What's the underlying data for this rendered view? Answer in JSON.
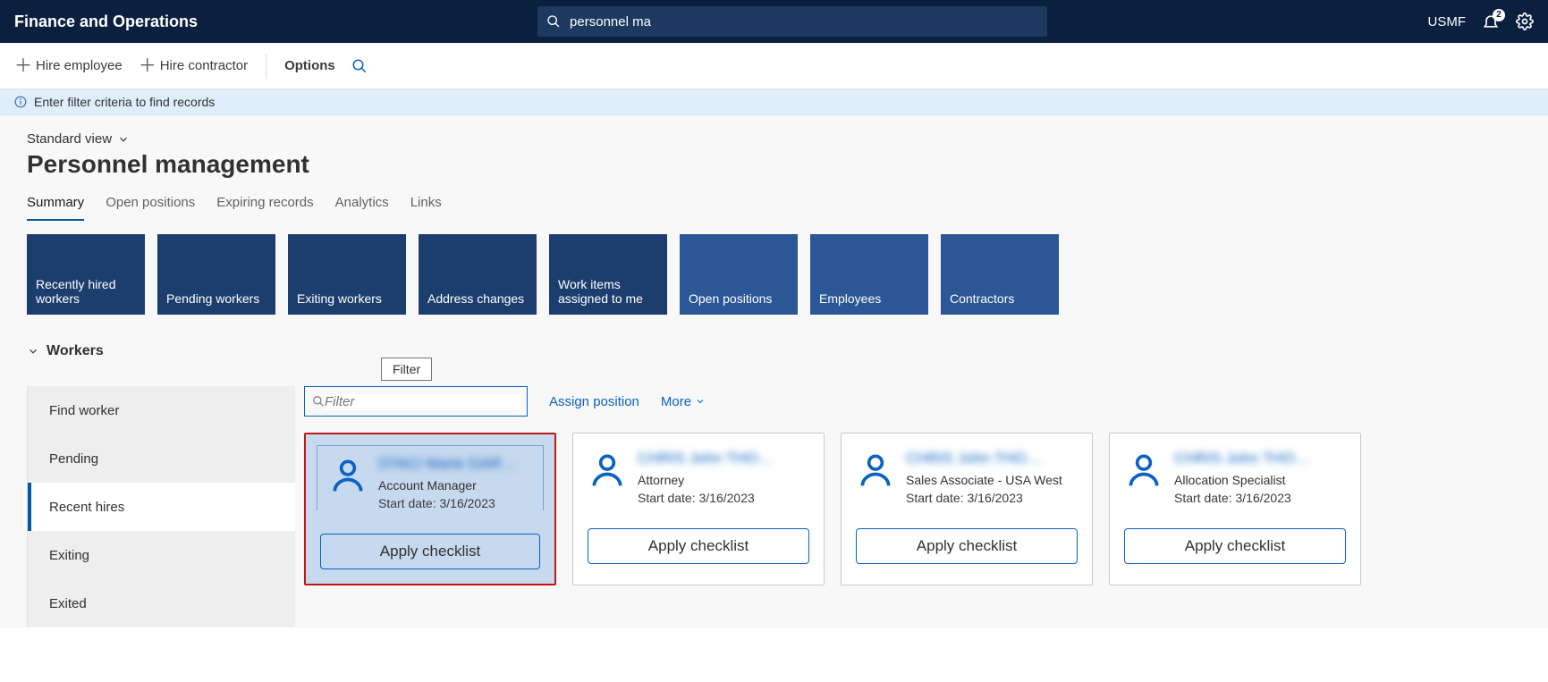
{
  "topbar": {
    "app_title": "Finance and Operations",
    "search_value": "personnel ma",
    "company": "USMF",
    "notification_count": "2"
  },
  "actionbar": {
    "hire_employee": "Hire employee",
    "hire_contractor": "Hire contractor",
    "options": "Options"
  },
  "infobar": {
    "message": "Enter filter criteria to find records"
  },
  "workspace": {
    "view_label": "Standard view",
    "page_title": "Personnel management"
  },
  "tabs": [
    {
      "label": "Summary",
      "active": true
    },
    {
      "label": "Open positions",
      "active": false
    },
    {
      "label": "Expiring records",
      "active": false
    },
    {
      "label": "Analytics",
      "active": false
    },
    {
      "label": "Links",
      "active": false
    }
  ],
  "tiles": [
    {
      "label": "Recently hired workers",
      "selected": true
    },
    {
      "label": "Pending workers",
      "selected": true
    },
    {
      "label": "Exiting workers",
      "selected": true
    },
    {
      "label": "Address changes",
      "selected": true
    },
    {
      "label": "Work items assigned to me",
      "selected": true
    },
    {
      "label": "Open positions",
      "selected": false
    },
    {
      "label": "Employees",
      "selected": false
    },
    {
      "label": "Contractors",
      "selected": false
    }
  ],
  "workers_section": {
    "heading": "Workers",
    "filter_tooltip": "Filter",
    "filter_placeholder": "Filter",
    "assign_position": "Assign position",
    "more": "More",
    "sidenav": [
      {
        "label": "Find worker",
        "active": false
      },
      {
        "label": "Pending",
        "active": false
      },
      {
        "label": "Recent hires",
        "active": true
      },
      {
        "label": "Exiting",
        "active": false
      },
      {
        "label": "Exited",
        "active": false
      }
    ],
    "cards": [
      {
        "name": "STACI Marie GAR…",
        "role": "Account Manager",
        "start_label": "Start date: 3/16/2023",
        "button": "Apply checklist",
        "selected": true
      },
      {
        "name": "CHRIS John THO…",
        "role": "Attorney",
        "start_label": "Start date: 3/16/2023",
        "button": "Apply checklist",
        "selected": false
      },
      {
        "name": "CHRIS John THO…",
        "role": "Sales Associate - USA West",
        "start_label": "Start date: 3/16/2023",
        "button": "Apply checklist",
        "selected": false
      },
      {
        "name": "CHRIS John THO…",
        "role": "Allocation Specialist",
        "start_label": "Start date: 3/16/2023",
        "button": "Apply checklist",
        "selected": false
      }
    ]
  }
}
